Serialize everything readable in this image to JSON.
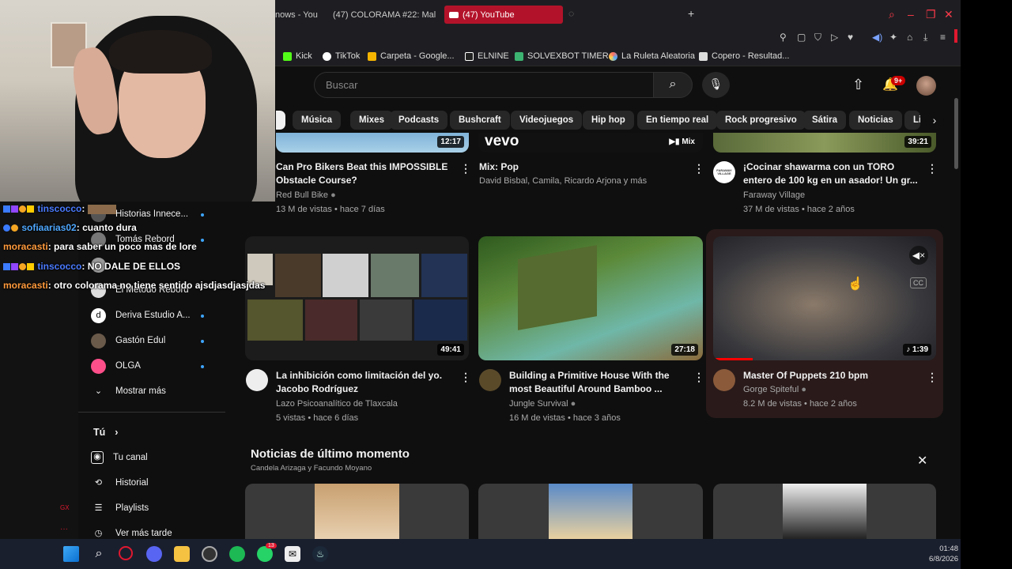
{
  "tabs": [
    {
      "label": "nows - You"
    },
    {
      "label": "(47) COLORAMA #22: Mal"
    },
    {
      "label": "(47) YouTube"
    }
  ],
  "bookmarks": [
    {
      "label": "Kick",
      "color": "#53fc18"
    },
    {
      "label": "TikTok",
      "color": "#ffffff"
    },
    {
      "label": "Carpeta - Google...",
      "color": "#f4b400"
    },
    {
      "label": "ELNINE",
      "color": "#ffffff"
    },
    {
      "label": "SOLVEXBOT TIMER",
      "color": "#3cb371"
    },
    {
      "label": "La Ruleta Aleatoria",
      "color": "#ff6f61"
    },
    {
      "label": "Copero - Resultad...",
      "color": "#dddddd"
    }
  ],
  "search": {
    "placeholder": "Buscar"
  },
  "notifications": {
    "count": "9+"
  },
  "chips": [
    "Música",
    "Mixes",
    "Podcasts",
    "Bushcraft",
    "Videojuegos",
    "Hip hop",
    "En tiempo real",
    "Rock progresivo",
    "Sátira",
    "Noticias",
    "Lio"
  ],
  "row1": [
    {
      "duration": "12:17",
      "title_line1": "Can Pro Bikers Beat this IMPOSSIBLE",
      "title_line2": "Obstacle Course?",
      "channel": "Red Bull Bike",
      "meta": "13 M de vistas • hace 7 días"
    },
    {
      "duration": "Mix",
      "brand": "vevo",
      "title_line1": "Mix: Pop",
      "title_line2": "",
      "channel": "David Bisbal, Camila, Ricardo Arjona y más",
      "meta": ""
    },
    {
      "duration": "39:21",
      "title_line1": "¡Cocinar shawarma con un TORO",
      "title_line2": "entero de 100 kg en un asador! Un gr...",
      "channel": "Faraway Village",
      "meta": "37 M de vistas • hace 2 años",
      "avatar_text": "FARAWAY VILLAGE"
    }
  ],
  "row2": [
    {
      "duration": "49:41",
      "title_line1": "La inhibición como limitación del yo.",
      "title_line2": "Jacobo Rodríguez",
      "channel": "Lazo Psicoanalítico de Tlaxcala",
      "meta": "5 vistas • hace 6 días"
    },
    {
      "duration": "27:18",
      "title_line1": "Building a Primitive House With the",
      "title_line2": "most Beautiful Around Bamboo ...",
      "channel": "Jungle Survival",
      "meta": "16 M de vistas • hace 3 años"
    },
    {
      "duration": "1:39",
      "title_line1": "Master Of Puppets 210 bpm",
      "title_line2": "",
      "channel": "Gorge Spiteful",
      "meta": "8.2 M de vistas • hace 2 años"
    }
  ],
  "sidebar": {
    "subs": [
      {
        "label": "Historias Innece..."
      },
      {
        "label": "Tomás Rebord"
      },
      {
        "label": "El Método Rebord"
      },
      {
        "label": "Deriva Estudio A..."
      },
      {
        "label": "Gastón Edul"
      },
      {
        "label": "OLGA"
      }
    ],
    "show_more": "Mostrar más",
    "you": "Tú",
    "your_channel": "Tu canal",
    "history": "Historial",
    "playlists": "Playlists",
    "see_later": "Ver más tarde"
  },
  "news": {
    "title": "Noticias de último momento",
    "subtitle": "Candela Arizaga y Facundo Moyano"
  },
  "chat": [
    {
      "user": "tinscocco",
      "user_color": "#4a7bff",
      "text": ":"
    },
    {
      "user": "sofiaarias02",
      "user_color": "#4fa8ff",
      "text": ": cuanto dura"
    },
    {
      "user": "moracasti",
      "user_color": "#ff9a3c",
      "text": ": para saber un poco mas de lore"
    },
    {
      "user": "tinscocco",
      "user_color": "#4a7bff",
      "text": ": NO DALE DE ELLOS"
    },
    {
      "user": "moracasti",
      "user_color": "#ff9a3c",
      "text": ": otro colorama no tiene sentido ajsdjasdjasjdas"
    }
  ],
  "clock": {
    "time": "01:48",
    "date": "6/8/2026"
  },
  "taskbar_badge": "13"
}
